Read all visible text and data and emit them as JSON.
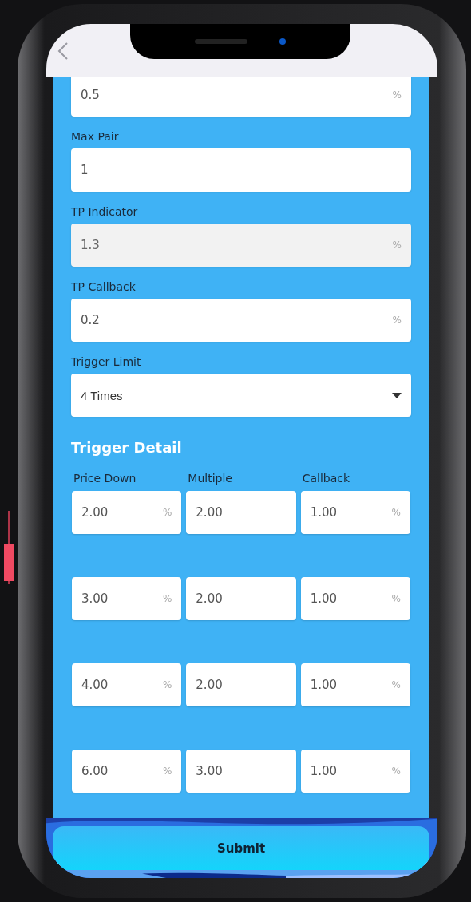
{
  "fields": [
    {
      "value": "0.5",
      "suffix": "%",
      "disabled": false
    },
    {
      "label": "Max Pair",
      "value": "1",
      "disabled": false
    },
    {
      "label": "TP Indicator",
      "value": "1.3",
      "suffix": "%",
      "disabled": true
    },
    {
      "label": "TP Callback",
      "value": "0.2",
      "suffix": "%",
      "disabled": false
    }
  ],
  "trigger_limit": {
    "label": "Trigger Limit",
    "value": "4 Times"
  },
  "trigger_detail": {
    "title": "Trigger Detail",
    "columns": [
      "Price Down",
      "Multiple",
      "Callback"
    ],
    "rows": [
      [
        {
          "value": "2.00",
          "suffix": "%"
        },
        {
          "value": "2.00"
        },
        {
          "value": "1.00",
          "suffix": "%"
        }
      ],
      [
        {
          "value": "3.00",
          "suffix": "%"
        },
        {
          "value": "2.00"
        },
        {
          "value": "1.00",
          "suffix": "%"
        }
      ],
      [
        {
          "value": "4.00",
          "suffix": "%"
        },
        {
          "value": "2.00"
        },
        {
          "value": "1.00",
          "suffix": "%"
        }
      ],
      [
        {
          "value": "6.00",
          "suffix": "%"
        },
        {
          "value": "3.00"
        },
        {
          "value": "1.00",
          "suffix": "%"
        }
      ]
    ]
  },
  "submit": "Submit"
}
